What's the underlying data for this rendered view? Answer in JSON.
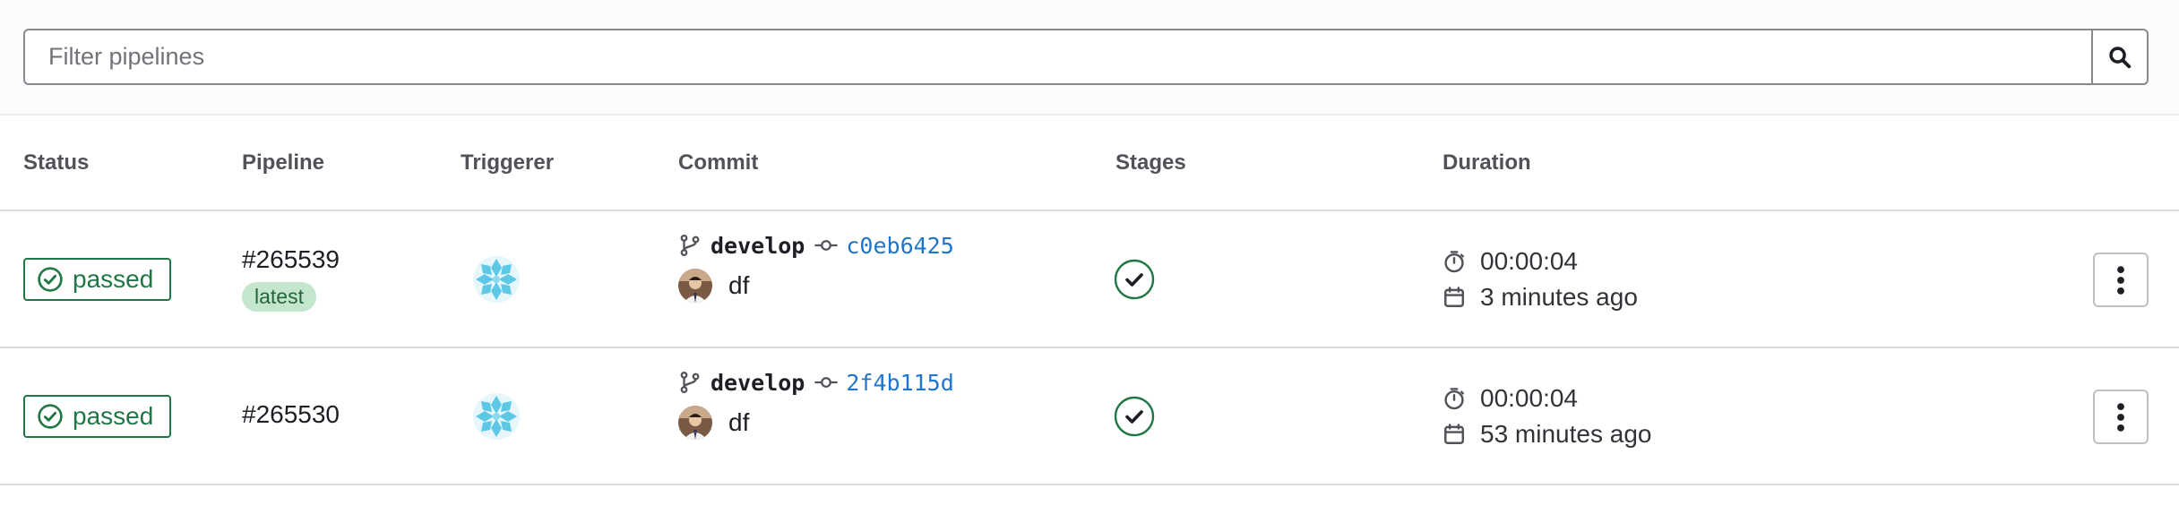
{
  "filter": {
    "placeholder": "Filter pipelines",
    "value": ""
  },
  "columns": {
    "status": "Status",
    "pipeline": "Pipeline",
    "triggerer": "Triggerer",
    "commit": "Commit",
    "stages": "Stages",
    "duration": "Duration"
  },
  "rows": [
    {
      "status": "passed",
      "pipeline_id": "#265539",
      "badge": "latest",
      "branch": "develop",
      "sha": "c0eb6425",
      "author": "df",
      "stage_status": "passed",
      "duration": "00:00:04",
      "finished": "3 minutes ago"
    },
    {
      "status": "passed",
      "pipeline_id": "#265530",
      "badge": "",
      "branch": "develop",
      "sha": "2f4b115d",
      "author": "df",
      "stage_status": "passed",
      "duration": "00:00:04",
      "finished": "53 minutes ago"
    }
  ],
  "colors": {
    "success": "#217645",
    "link": "#1f75cb",
    "latest_bg": "#c3e6cd",
    "border": "#dcdcde"
  },
  "icons": {
    "search": "search-icon",
    "status": "check-circle-icon",
    "branch": "branch-icon",
    "commit": "commit-icon",
    "stage": "check-circle-filled-icon",
    "duration": "timer-icon",
    "finished": "calendar-icon",
    "actions": "kebab-menu-icon"
  }
}
